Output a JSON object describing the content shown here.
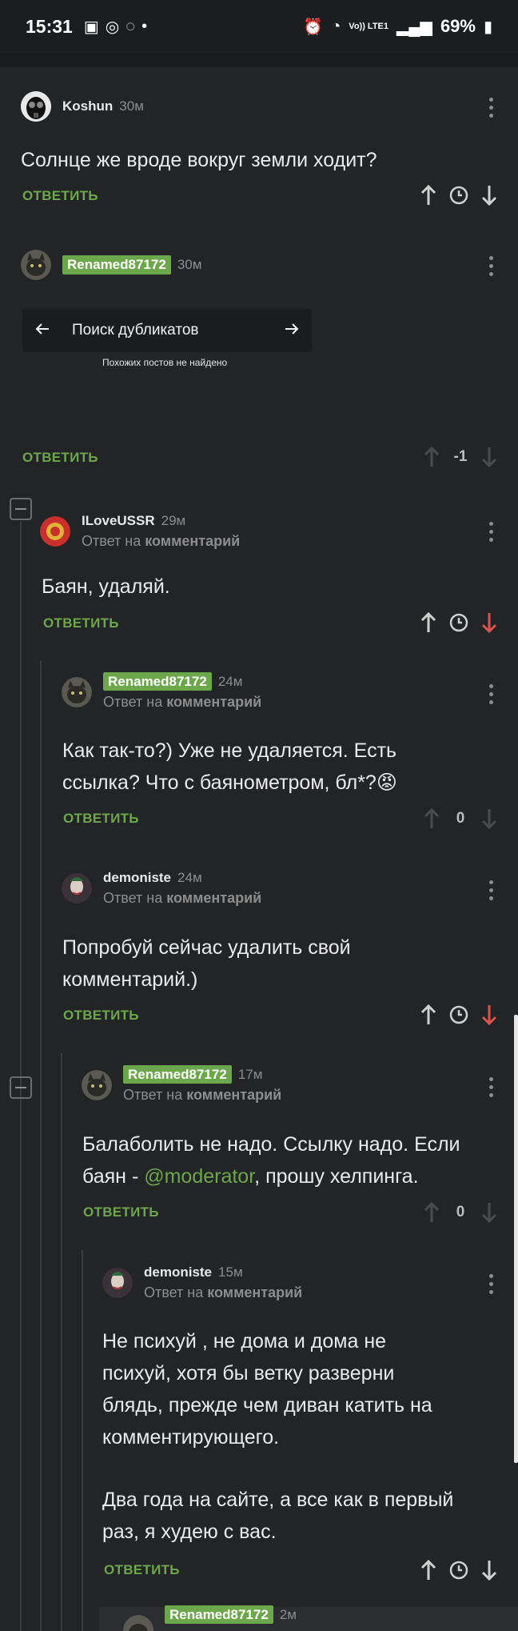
{
  "status_bar": {
    "time": "15:31",
    "signal_label": "Vo)) LTE1",
    "battery": "69%"
  },
  "duplicates": {
    "title": "Поиск дубликатов",
    "empty_text": "Похожих постов не найдено"
  },
  "reply_label": "ОТВЕТИТЬ",
  "reply_to_prefix": "Ответ на",
  "reply_to_target": "комментарий",
  "comments": [
    {
      "user": "Koshun",
      "time": "30м",
      "text": "Солнце же вроде вокруг земли ходит?"
    },
    {
      "user": "Renamed87172",
      "time": "30м",
      "score": "-1"
    },
    {
      "user": "ILoveUSSR",
      "time": "29м",
      "text": "Баян, удаляй."
    },
    {
      "user": "Renamed87172",
      "time": "24м",
      "text_lines": [
        "Как так-то?) Уже не удаляется. Есть",
        "ссылка? Что с баянометром, бл*?😡"
      ],
      "score": "0"
    },
    {
      "user": "demoniste",
      "time": "24м",
      "text_lines": [
        "Попробуй сейчас удалить свой",
        "комментарий.)"
      ]
    },
    {
      "user": "Renamed87172",
      "time": "17м",
      "text_lines": [
        "Балаболить не надо. Ссылку надо. Если",
        "баян - "
      ],
      "mention": "@moderator",
      "text_after_mention": ", прошу хелпинга.",
      "score": "0"
    },
    {
      "user": "demoniste",
      "time": "15м",
      "text_lines": [
        "Не психуй , не дома и дома не",
        "психуй, хотя бы ветку разверни",
        "блядь, прежде чем диван катить на",
        "комментирующего.",
        "",
        "Два года на сайте, а все как в первый",
        "раз, я худею с вас."
      ]
    },
    {
      "user": "Renamed87172",
      "time": "2м"
    }
  ],
  "colors": {
    "background": "#232426",
    "accent_green": "#6ca74b",
    "downvote_red": "#d9534f",
    "muted": "#8d8d8d"
  }
}
